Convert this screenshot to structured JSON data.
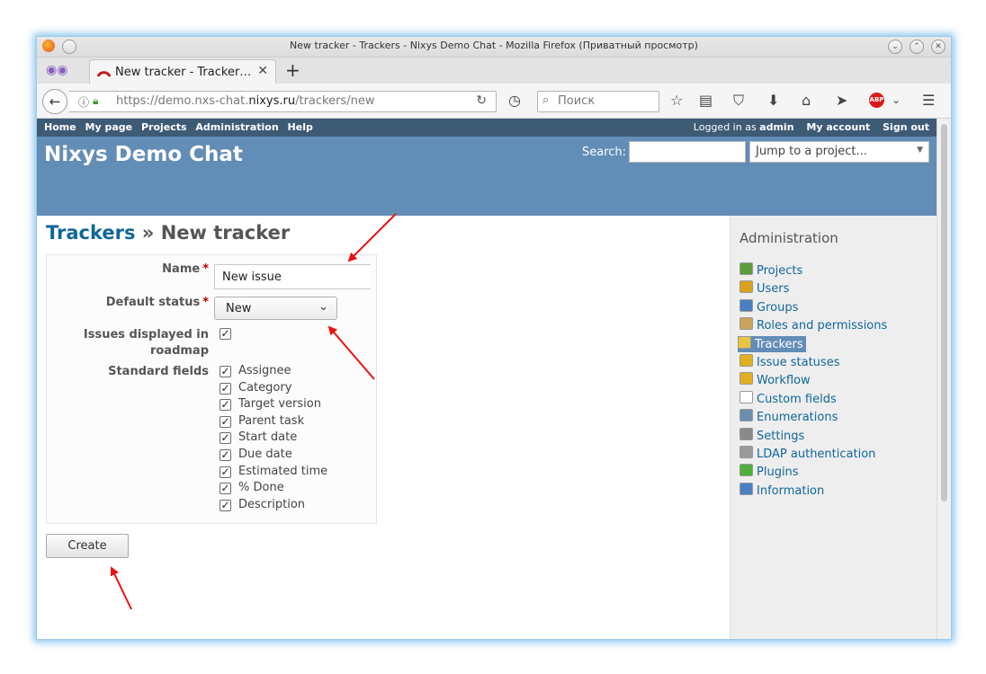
{
  "window": {
    "title": "New tracker - Trackers - Nixys Demo Chat - Mozilla Firefox (Приватный просмотр)"
  },
  "browser": {
    "tab_title": "New tracker - Tracker…",
    "url_prefix": "https://demo.nxs-chat.",
    "url_domain": "nixys.ru",
    "url_suffix": "/trackers/new",
    "search_placeholder": "Поиск"
  },
  "top_menu": {
    "items": [
      "Home",
      "My page",
      "Projects",
      "Administration",
      "Help"
    ],
    "logged_in_prefix": "Logged in as ",
    "logged_in_user": "admin",
    "my_account": "My account",
    "sign_out": "Sign out"
  },
  "header": {
    "site_title": "Nixys Demo Chat",
    "search_label": "Search:",
    "jump_placeholder": "Jump to a project..."
  },
  "main": {
    "breadcrumb_link": "Trackers",
    "breadcrumb_sep": " » ",
    "page_title": "New tracker",
    "form": {
      "name_label": "Name",
      "name_value": "New issue",
      "required_mark": "*",
      "status_label": "Default status",
      "status_value": "New",
      "roadmap_label_line1": "Issues displayed in",
      "roadmap_label_line2": "roadmap",
      "roadmap_checked": true,
      "standard_fields_label": "Standard fields",
      "standard_fields": [
        "Assignee",
        "Category",
        "Target version",
        "Parent task",
        "Start date",
        "Due date",
        "Estimated time",
        "% Done",
        "Description"
      ]
    },
    "create_button": "Create"
  },
  "sidebar": {
    "title": "Administration",
    "items": [
      {
        "label": "Projects",
        "icon": "projects-icon",
        "color": "#5a9e3a"
      },
      {
        "label": "Users",
        "icon": "user-icon",
        "color": "#d9a21b"
      },
      {
        "label": "Groups",
        "icon": "group-icon",
        "color": "#4a7fc1"
      },
      {
        "label": "Roles and permissions",
        "icon": "roles-icon",
        "color": "#c9a45a"
      },
      {
        "label": "Trackers",
        "icon": "tracker-icon",
        "color": "#e8c440"
      },
      {
        "label": "Issue statuses",
        "icon": "issue-statuses-icon",
        "color": "#e0b020"
      },
      {
        "label": "Workflow",
        "icon": "workflow-icon",
        "color": "#e0b020"
      },
      {
        "label": "Custom fields",
        "icon": "custom-fields-icon",
        "color": "#ffffff"
      },
      {
        "label": "Enumerations",
        "icon": "list-icon",
        "color": "#6b8db0"
      },
      {
        "label": "Settings",
        "icon": "gear-icon",
        "color": "#8a8a8a"
      },
      {
        "label": "LDAP authentication",
        "icon": "ldap-icon",
        "color": "#9a9a9a"
      },
      {
        "label": "Plugins",
        "icon": "plugin-icon",
        "color": "#4caf38"
      },
      {
        "label": "Information",
        "icon": "info-icon",
        "color": "#4a7fc1"
      }
    ],
    "selected": "Trackers"
  },
  "colors": {
    "top_menu_bg": "#3e5b76",
    "header_bg": "#628db6",
    "link": "#116699",
    "annotation_arrow": "#ee1111"
  }
}
